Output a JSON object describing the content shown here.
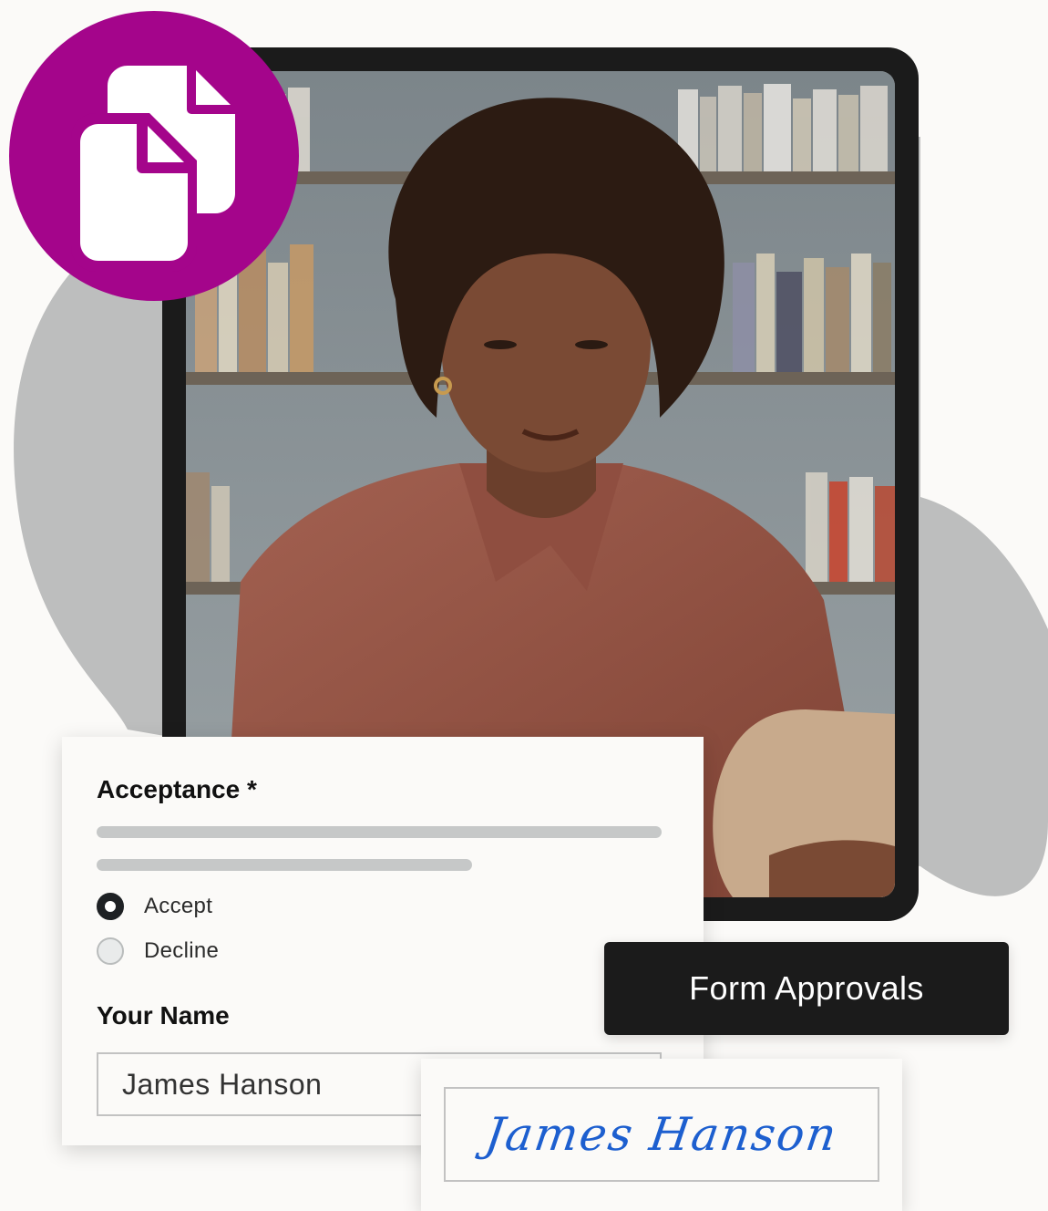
{
  "form": {
    "acceptance_heading": "Acceptance *",
    "options": [
      {
        "label": "Accept",
        "selected": true
      },
      {
        "label": "Decline",
        "selected": false
      }
    ],
    "name_heading": "Your Name",
    "name_value": "James Hanson"
  },
  "tag": {
    "label": "Form Approvals"
  },
  "signature": {
    "text": "James Hanson"
  },
  "logo": {
    "icon": "documents-icon",
    "color": "#a4058b"
  },
  "colors": {
    "accent": "#a4058b",
    "dark": "#1b1b1b",
    "signature_ink": "#1d5fcf"
  }
}
